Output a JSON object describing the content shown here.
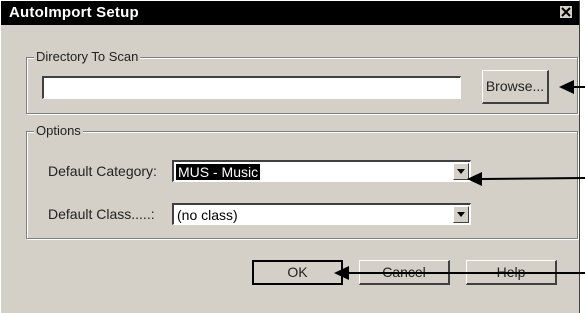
{
  "window": {
    "title": "AutoImport Setup",
    "close_icon": "close-icon"
  },
  "directory_group": {
    "label": "Directory To Scan",
    "path_value": "",
    "browse_label": "Browse..."
  },
  "options_group": {
    "label": "Options",
    "category_label": "Default Category:",
    "category_value": "MUS - Music",
    "class_label": "Default Class.....:",
    "class_value": "(no class)"
  },
  "buttons": {
    "ok": "OK",
    "cancel": "Cancel",
    "help": "Help"
  },
  "colors": {
    "dialog_face": "#d4d0c8",
    "titlebar": "#000000",
    "selection": "#000000"
  }
}
